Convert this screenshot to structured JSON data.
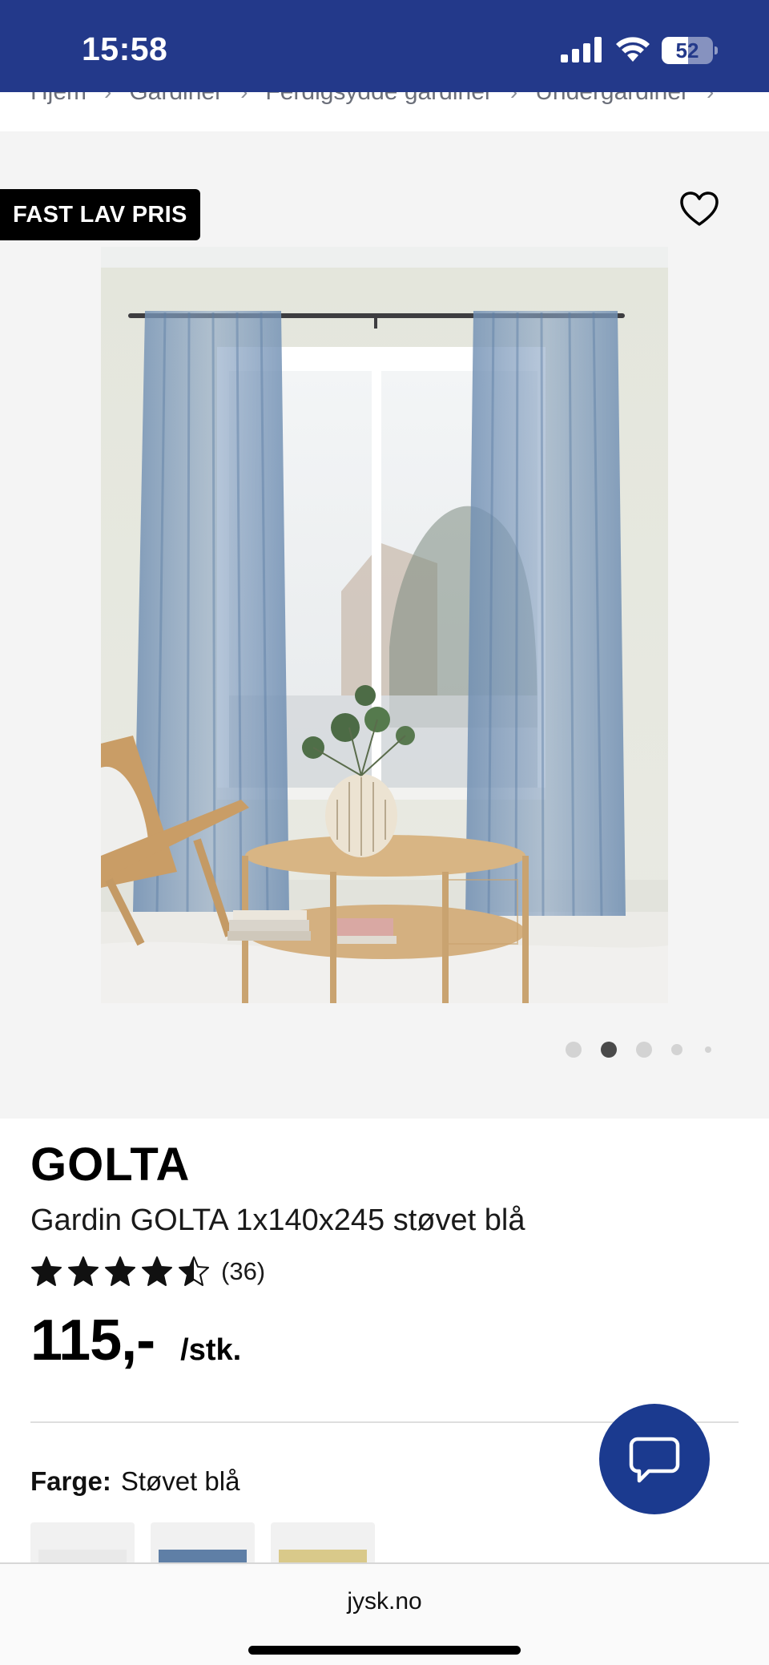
{
  "status_bar": {
    "time": "15:58",
    "battery_level": "52",
    "battery_fraction": 0.52
  },
  "breadcrumb": {
    "items": [
      "Hjem",
      "Gardiner",
      "Ferdigsydde gardiner",
      "Undergardiner"
    ]
  },
  "gallery": {
    "badge": "FAST LAV PRIS",
    "wishlist_icon": "heart-icon",
    "image_count": 5,
    "active_index": 1
  },
  "product": {
    "brand": "GOLTA",
    "title": "Gardin GOLTA 1x140x245 støvet blå",
    "rating": 4.5,
    "review_count": "(36)",
    "price": "115,-",
    "unit": "/stk.",
    "color_label": "Farge:",
    "color_value": "Støvet blå",
    "swatches": [
      {
        "name": "white",
        "color": "#e9e9e9"
      },
      {
        "name": "støvet blå",
        "color": "#5f7fa6"
      },
      {
        "name": "yellow",
        "color": "#d9c98a"
      }
    ]
  },
  "chat": {
    "icon": "chat-bubble-icon",
    "color": "#1b3a8f"
  },
  "browser": {
    "url": "jysk.no"
  },
  "colors": {
    "brand_blue": "#23398a",
    "badge_black": "#000000",
    "gallery_bg": "#f4f4f4"
  }
}
